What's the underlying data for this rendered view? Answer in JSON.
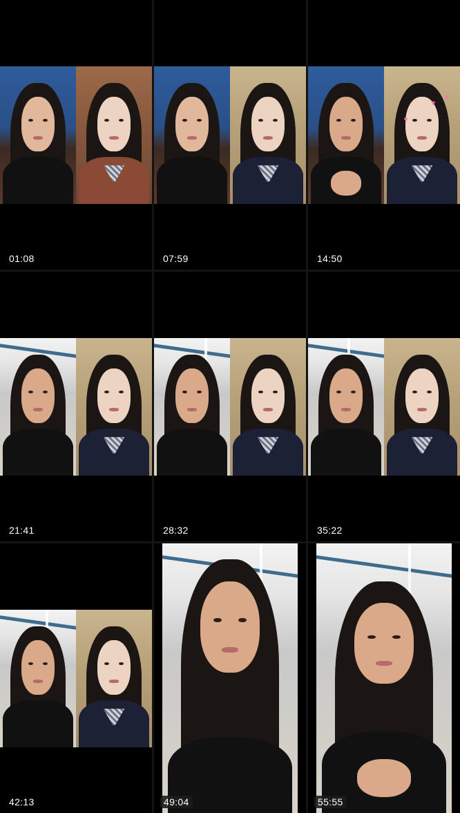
{
  "grid": {
    "tiles": [
      {
        "duration": "01:08",
        "label": "Video duration 01:08"
      },
      {
        "duration": "07:59",
        "label": "Video duration 07:59"
      },
      {
        "duration": "14:50",
        "label": "Video duration 14:50"
      },
      {
        "duration": "21:41",
        "label": "Video duration 21:41"
      },
      {
        "duration": "28:32",
        "label": "Video duration 28:32"
      },
      {
        "duration": "35:22",
        "label": "Video duration 35:22"
      },
      {
        "duration": "42:13",
        "label": "Video duration 42:13"
      },
      {
        "duration": "49:04",
        "label": "Video duration 49:04"
      },
      {
        "duration": "55:55",
        "label": "Video duration 55:55"
      }
    ]
  },
  "colors": {
    "background": "#000000",
    "gutter": "#141414",
    "duration_text": "#ffffff"
  }
}
